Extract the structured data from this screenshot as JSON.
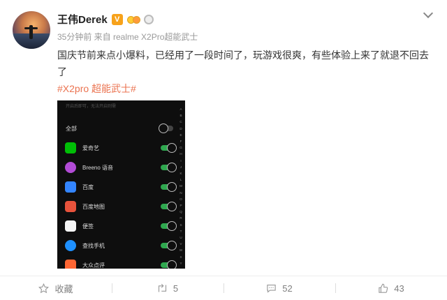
{
  "post": {
    "author": "王伟Derek",
    "verified_badge": "V",
    "time_source": "35分钟前 来自 realme X2Pro超能武士",
    "body": "国庆节前来点小爆料，已经用了一段时间了，玩游戏很爽，有些体验上来了就退不回去了",
    "hashtag": "#X2pro 超能武士#"
  },
  "screenshot": {
    "hint": "开启后即可，无法开启则需",
    "all_label": "全部",
    "apps": [
      {
        "name": "爱奇艺",
        "icon": "iqiyi-icon",
        "color": "#00be06",
        "on": true
      },
      {
        "name": "Breeno 语音",
        "icon": "breeno-icon",
        "color": "#b24bd6",
        "on": true
      },
      {
        "name": "百度",
        "icon": "baidu-icon",
        "color": "#3385ff",
        "on": true
      },
      {
        "name": "百度地图",
        "icon": "baidu-map-icon",
        "color": "#e8533c",
        "on": true
      },
      {
        "name": "便签",
        "icon": "notes-icon",
        "color": "#f5f5f5",
        "on": true
      },
      {
        "name": "查找手机",
        "icon": "find-phone-icon",
        "color": "#1e90ff",
        "on": true
      },
      {
        "name": "大众点评",
        "icon": "dianping-icon",
        "color": "#ff6633",
        "on": true
      }
    ],
    "alphabet": "ABCDEFGHIJKLMNOPQRSTUVWXYZ#"
  },
  "actions": {
    "favorite_label": "收藏",
    "repost_count": "5",
    "comment_count": "52",
    "like_count": "43"
  },
  "colors": {
    "accent": "#eb7350",
    "toggle_on": "#2fa84f"
  }
}
